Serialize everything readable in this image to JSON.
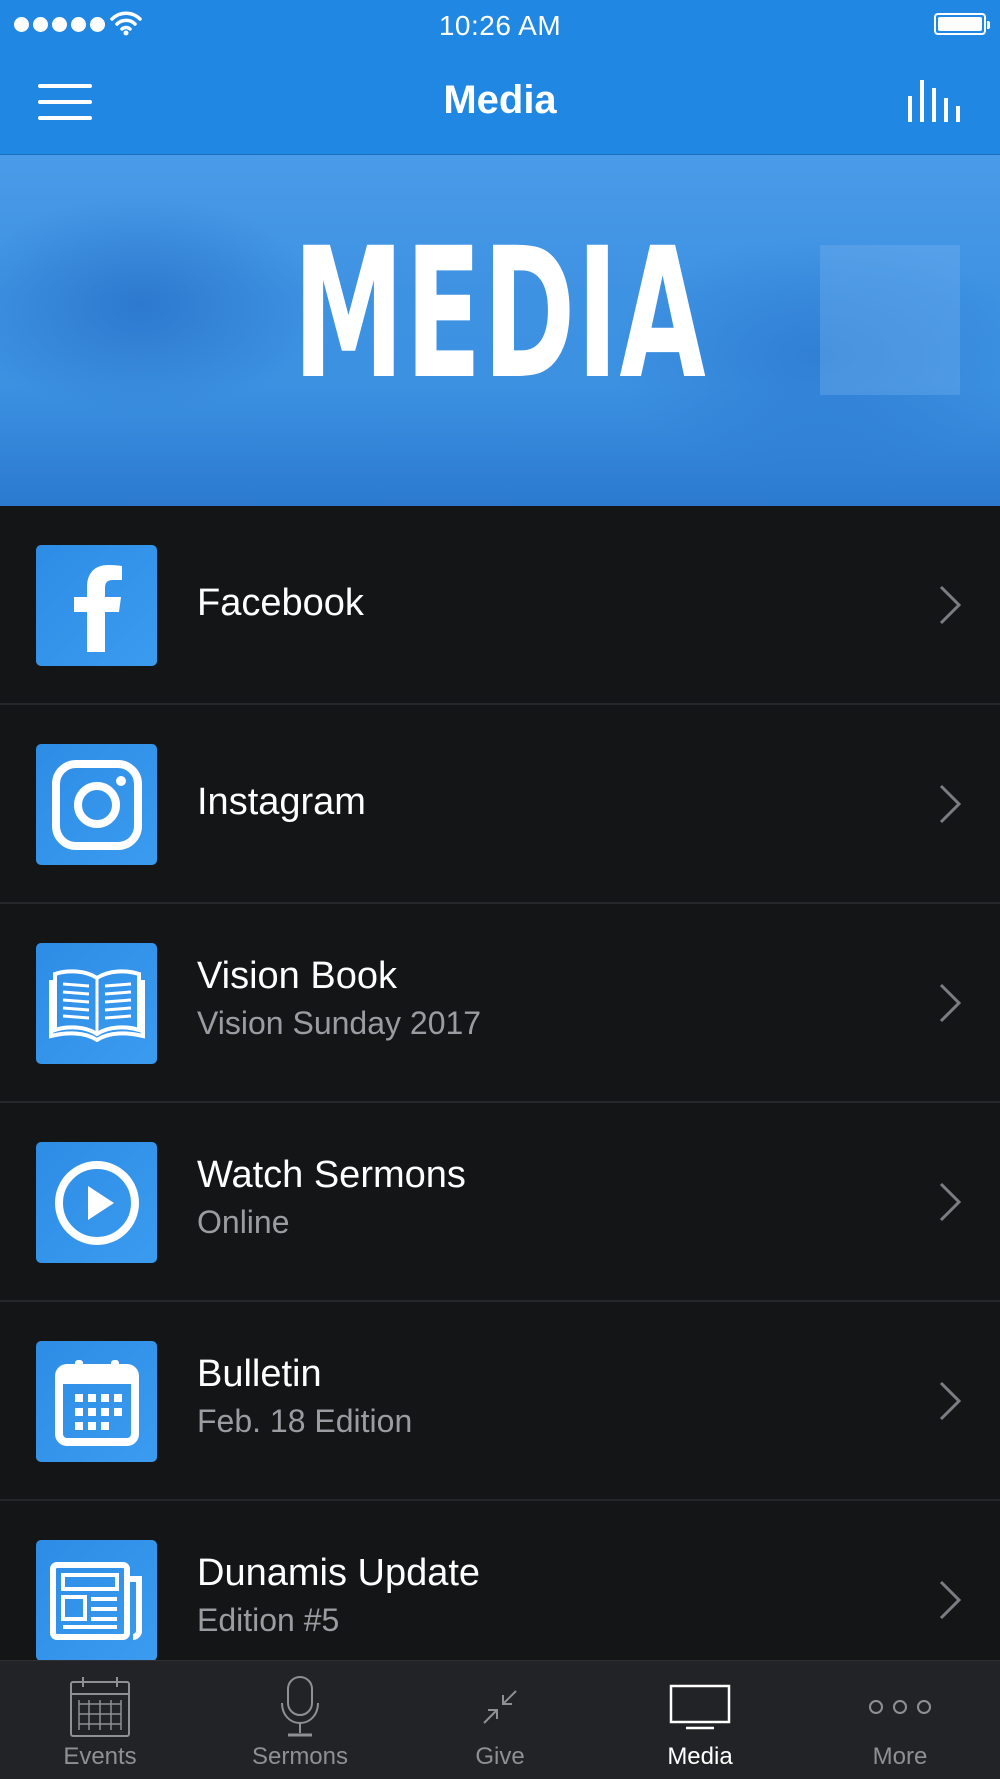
{
  "status_bar": {
    "time": "10:26 AM"
  },
  "nav": {
    "title": "Media"
  },
  "hero": {
    "text": "MEDIA"
  },
  "list": [
    {
      "title": "Facebook",
      "subtitle": "",
      "icon": "facebook-icon"
    },
    {
      "title": "Instagram",
      "subtitle": "",
      "icon": "instagram-icon"
    },
    {
      "title": "Vision Book",
      "subtitle": "Vision Sunday 2017",
      "icon": "open-book-icon"
    },
    {
      "title": "Watch Sermons",
      "subtitle": "Online",
      "icon": "play-circle-icon"
    },
    {
      "title": "Bulletin",
      "subtitle": "Feb. 18 Edition",
      "icon": "calendar-icon"
    },
    {
      "title": "Dunamis Update",
      "subtitle": "Edition #5",
      "icon": "newspaper-icon"
    }
  ],
  "tabs": [
    {
      "label": "Events",
      "icon": "calendar-icon"
    },
    {
      "label": "Sermons",
      "icon": "microphone-icon"
    },
    {
      "label": "Give",
      "icon": "arrows-in-icon"
    },
    {
      "label": "Media",
      "icon": "tv-icon",
      "active": true
    },
    {
      "label": "More",
      "icon": "ellipsis-icon"
    }
  ],
  "colors": {
    "accent": "#2087e3",
    "background": "#141517",
    "tab_bar": "#222326",
    "subtitle": "#9a9ca1",
    "tab_inactive": "#8e9095"
  }
}
